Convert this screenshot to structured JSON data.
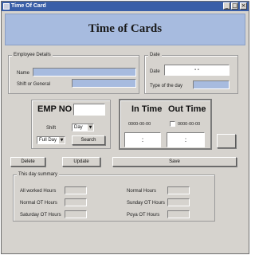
{
  "window": {
    "title": "Time Of Card",
    "controls": {
      "minimize": "_",
      "maximize": "□",
      "close": "×"
    }
  },
  "header": {
    "title": "Time of Cards"
  },
  "employee_details": {
    "legend": "Employee Details",
    "name_label": "Name",
    "shift_label": "Shift or General",
    "name_value": "",
    "shift_value": ""
  },
  "date_panel": {
    "legend": "Date",
    "date_label": "Date",
    "date_value": "- -",
    "type_label": "Type of the day",
    "type_value": ""
  },
  "emp_panel": {
    "emp_no_label": "EMP NO",
    "emp_no_value": "",
    "shift_label": "Shift",
    "shift_value": "Day",
    "period_value": "Full Day",
    "search_label": "Search"
  },
  "time_panel": {
    "in_label": "In Time",
    "out_label": "Out Time",
    "in_date": "0000-00-00",
    "out_date": "0000-00-00",
    "in_time": ":",
    "out_time": ":"
  },
  "actions": {
    "delete": "Delete",
    "update": "Update",
    "save": "Save"
  },
  "summary": {
    "legend": "This day summary",
    "all_worked": "All worked Hours",
    "normal": "Normal Hours",
    "normal_ot": "Normal OT Hours",
    "sunday_ot": "Sunday OT Hours",
    "saturday_ot": "Saturday OT Hours",
    "poya_ot": "Poya OT Hours"
  },
  "colors": {
    "window_bg": "#d6d3ce",
    "header_bg": "#a7bbdf",
    "titlebar": "#3a5fa8"
  }
}
